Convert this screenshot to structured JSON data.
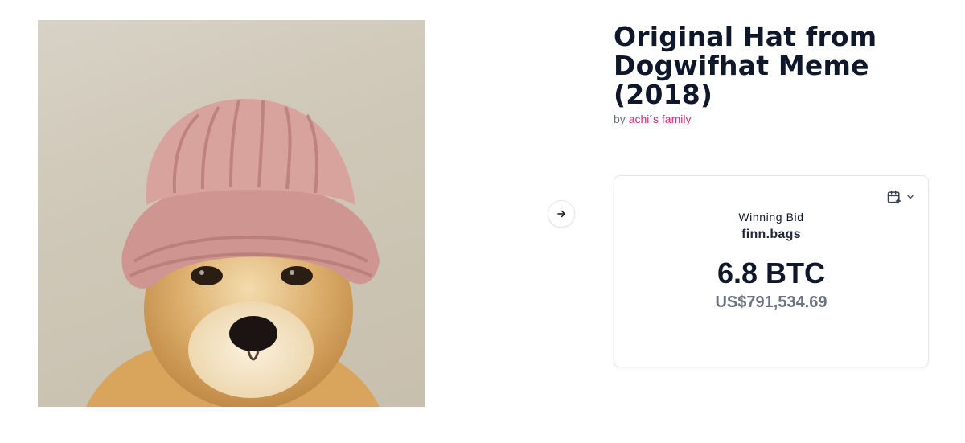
{
  "artwork": {
    "alt": "Shiba Inu dog wearing a pink knitted hat",
    "icon": "dog-with-pink-hat"
  },
  "navigation": {
    "next_icon": "arrow-right-icon"
  },
  "listing": {
    "title": "Original Hat from Dogwifhat Meme (2018)",
    "by_prefix": "by",
    "creator": "achi´s family"
  },
  "auction": {
    "calendar_icon": "calendar-plus-icon",
    "dropdown_icon": "chevron-down-icon",
    "bid_label": "Winning Bid",
    "bidder": "finn.bags",
    "amount": "6.8 BTC",
    "usd_amount": "US$791,534.69"
  },
  "colors": {
    "accent": "#db2777",
    "heading": "#0f172a",
    "muted": "#6b7280"
  }
}
